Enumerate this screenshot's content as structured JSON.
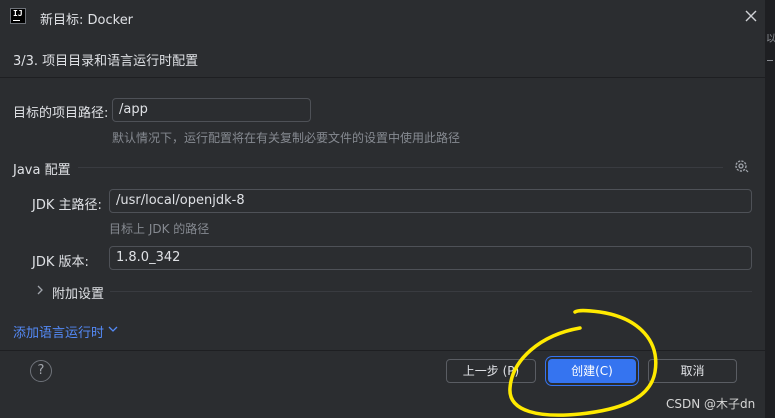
{
  "window": {
    "title": "新目标: Docker",
    "logo_text": "IJ"
  },
  "step": {
    "title": "3/3. 项目目录和语言运行时配置"
  },
  "project": {
    "path_label": "目标的项目路径:",
    "path_value": "/app",
    "path_hint": "默认情况下，运行配置将在有关复制必要文件的设置中使用此路径"
  },
  "java": {
    "section_title": "Java 配置",
    "jdk_home_label": "JDK 主路径:",
    "jdk_home_value": "/usr/local/openjdk-8",
    "jdk_home_hint": "目标上 JDK 的路径",
    "jdk_version_label": "JDK 版本:",
    "jdk_version_value": "1.8.0_342",
    "additional_settings": "附加设置"
  },
  "add_runtime_link": "添加语言运行时",
  "footer": {
    "help": "?",
    "prev_button": "上一步 (P)",
    "create_button": "创建(C)",
    "cancel_button": "取消"
  },
  "watermark": "CSDN @木子dn",
  "edge_glyph": "以",
  "colors": {
    "accent": "#3574f0",
    "link": "#548af7",
    "annotation": "#ffea00"
  }
}
